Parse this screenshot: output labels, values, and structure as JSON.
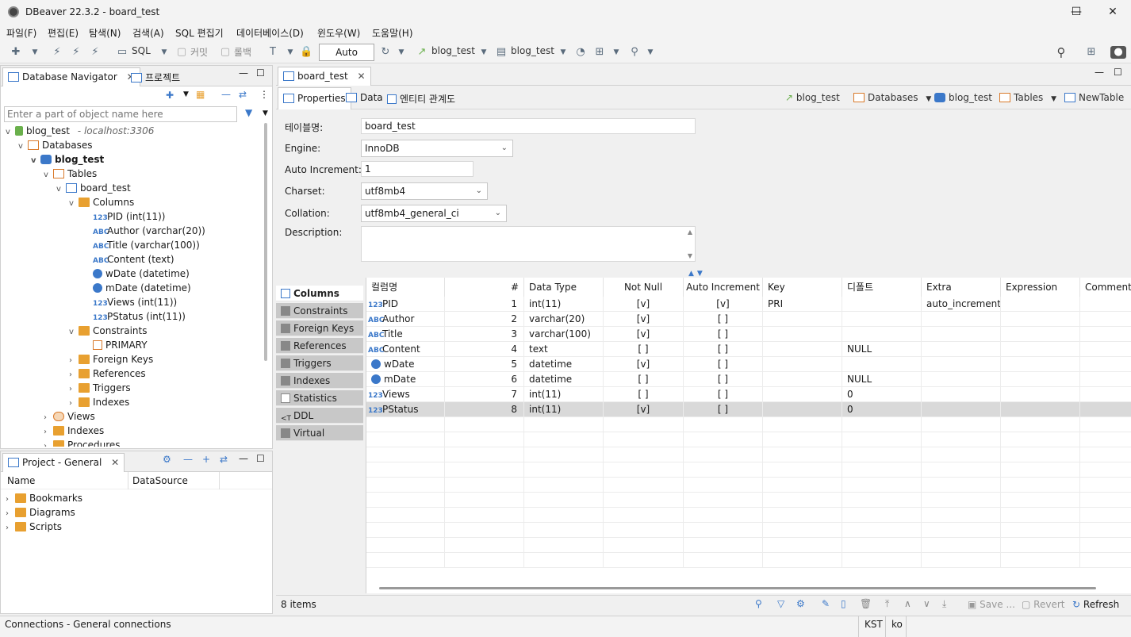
{
  "window": {
    "title": "DBeaver 22.3.2 - board_test"
  },
  "menu": [
    "파일(F)",
    "편집(E)",
    "탐색(N)",
    "검색(A)",
    "SQL 편집기",
    "데이터베이스(D)",
    "윈도우(W)",
    "도움말(H)"
  ],
  "toolbar": {
    "sql_label": "SQL",
    "commit_label": "커밋",
    "rollback_label": "롤백",
    "auto_label": "Auto",
    "datasource": "blog_test",
    "schema": "blog_test"
  },
  "navigator": {
    "tab_label": "Database Navigator",
    "project_tab_label": "프로젝트",
    "filter_placeholder": "Enter a part of object name here",
    "connection": "blog_test",
    "connection_host": "- localhost:3306",
    "databases": "Databases",
    "database": "blog_test",
    "tables": "Tables",
    "table": "board_test",
    "columns_folder": "Columns",
    "columns": [
      {
        "icon": "123",
        "label": "PID (int(11))"
      },
      {
        "icon": "ABC",
        "label": "Author (varchar(20))"
      },
      {
        "icon": "ABC",
        "label": "Title (varchar(100))"
      },
      {
        "icon": "ABC",
        "label": "Content (text)"
      },
      {
        "icon": "clock",
        "label": "wDate (datetime)"
      },
      {
        "icon": "clock",
        "label": "mDate (datetime)"
      },
      {
        "icon": "123",
        "label": "Views (int(11))"
      },
      {
        "icon": "123",
        "label": "PStatus (int(11))"
      }
    ],
    "constraints_folder": "Constraints",
    "constraint_primary": "PRIMARY",
    "foreign_keys": "Foreign Keys",
    "references": "References",
    "triggers": "Triggers",
    "indexes": "Indexes",
    "views": "Views",
    "db_indexes": "Indexes",
    "procedures": "Procedures"
  },
  "project": {
    "tab_label": "Project - General",
    "col_name": "Name",
    "col_datasource": "DataSource",
    "items": [
      "Bookmarks",
      "Diagrams",
      "Scripts"
    ]
  },
  "editor": {
    "tab_label": "board_test",
    "subtabs": [
      "Properties",
      "Data",
      "엔티티 관계도"
    ],
    "breadcrumb": [
      "blog_test",
      "Databases",
      "blog_test",
      "Tables",
      "NewTable"
    ],
    "form": {
      "table_name_label": "테이블명:",
      "table_name": "board_test",
      "engine_label": "Engine:",
      "engine": "InnoDB",
      "auto_inc_label": "Auto Increment:",
      "auto_inc": "1",
      "charset_label": "Charset:",
      "charset": "utf8mb4",
      "collation_label": "Collation:",
      "collation": "utf8mb4_general_ci",
      "description_label": "Description:"
    },
    "side_tabs": [
      "Columns",
      "Constraints",
      "Foreign Keys",
      "References",
      "Triggers",
      "Indexes",
      "Statistics",
      "DDL",
      "Virtual"
    ],
    "grid_headers": [
      "컬럼명",
      "#",
      "Data Type",
      "Not Null",
      "Auto Increment",
      "Key",
      "디폴트",
      "Extra",
      "Expression",
      "Comment"
    ],
    "rows": [
      {
        "icon": "123",
        "name": "PID",
        "num": "1",
        "type": "int(11)",
        "notnull": "[v]",
        "autoinc": "[v]",
        "key": "PRI",
        "default": "",
        "extra": "auto_increment"
      },
      {
        "icon": "ABC",
        "name": "Author",
        "num": "2",
        "type": "varchar(20)",
        "notnull": "[v]",
        "autoinc": "[ ]",
        "key": "",
        "default": "",
        "extra": ""
      },
      {
        "icon": "ABC",
        "name": "Title",
        "num": "3",
        "type": "varchar(100)",
        "notnull": "[v]",
        "autoinc": "[ ]",
        "key": "",
        "default": "",
        "extra": ""
      },
      {
        "icon": "ABC",
        "name": "Content",
        "num": "4",
        "type": "text",
        "notnull": "[ ]",
        "autoinc": "[ ]",
        "key": "",
        "default": "NULL",
        "extra": ""
      },
      {
        "icon": "clock",
        "name": "wDate",
        "num": "5",
        "type": "datetime",
        "notnull": "[v]",
        "autoinc": "[ ]",
        "key": "",
        "default": "",
        "extra": ""
      },
      {
        "icon": "clock",
        "name": "mDate",
        "num": "6",
        "type": "datetime",
        "notnull": "[ ]",
        "autoinc": "[ ]",
        "key": "",
        "default": "NULL",
        "extra": ""
      },
      {
        "icon": "123",
        "name": "Views",
        "num": "7",
        "type": "int(11)",
        "notnull": "[ ]",
        "autoinc": "[ ]",
        "key": "",
        "default": "0",
        "extra": ""
      },
      {
        "icon": "123",
        "name": "PStatus",
        "num": "8",
        "type": "int(11)",
        "notnull": "[v]",
        "autoinc": "[ ]",
        "key": "",
        "default": "0",
        "extra": ""
      }
    ],
    "items_count": "8 items",
    "save_label": "Save ...",
    "revert_label": "Revert",
    "refresh_label": "Refresh"
  },
  "status": {
    "connections": "Connections - General connections",
    "timezone": "KST",
    "locale": "ko"
  }
}
